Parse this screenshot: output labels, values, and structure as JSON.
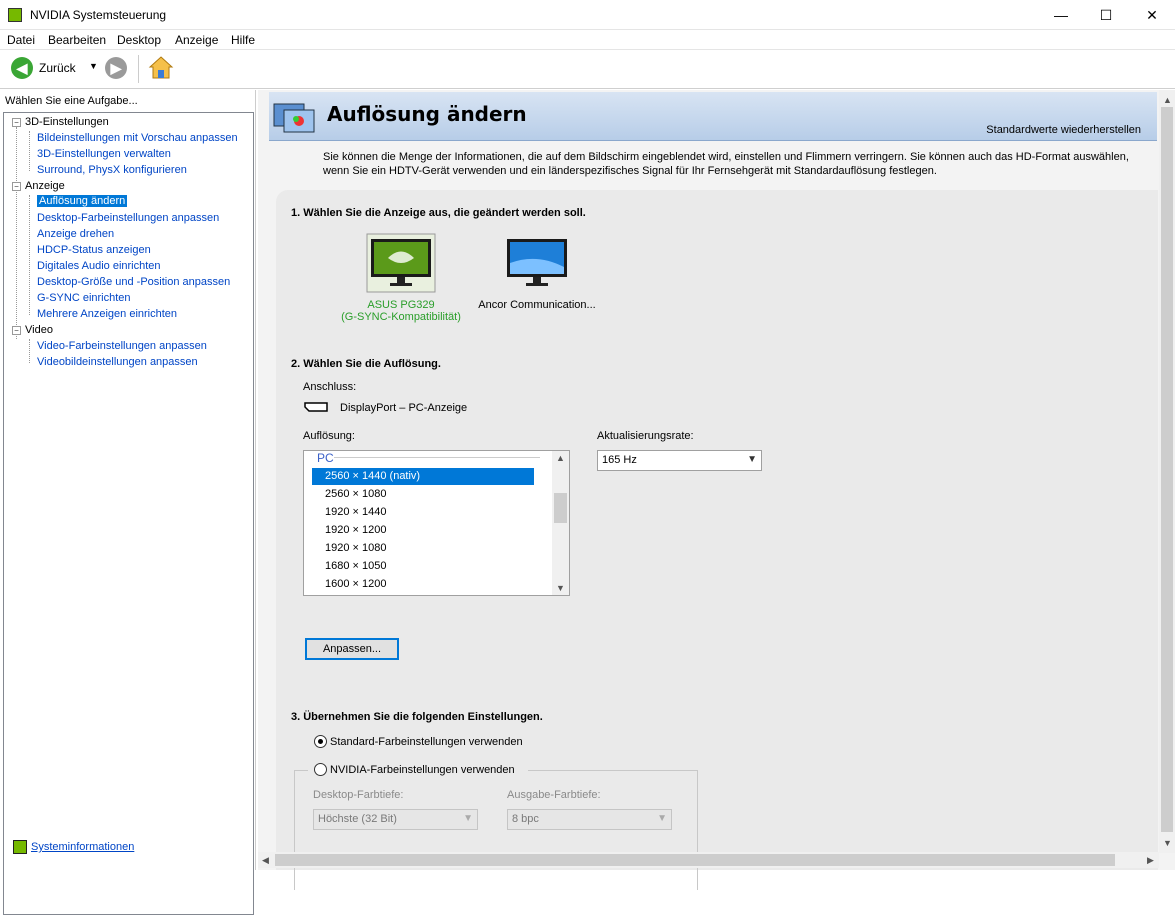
{
  "window": {
    "title": "NVIDIA Systemsteuerung",
    "min": "—",
    "max": "☐",
    "close": "✕"
  },
  "menu": [
    "Datei",
    "Bearbeiten",
    "Desktop",
    "Anzeige",
    "Hilfe"
  ],
  "toolbar": {
    "back_label": "Zurück"
  },
  "tasks": {
    "header": "Wählen Sie eine Aufgabe...",
    "categories": [
      {
        "label": "3D-Einstellungen",
        "items": [
          "Bildeinstellungen mit Vorschau anpassen",
          "3D-Einstellungen verwalten",
          "Surround, PhysX konfigurieren"
        ]
      },
      {
        "label": "Anzeige",
        "items": [
          "Auflösung ändern",
          "Desktop-Farbeinstellungen anpassen",
          "Anzeige drehen",
          "HDCP-Status anzeigen",
          "Digitales Audio einrichten",
          "Desktop-Größe und -Position anpassen",
          "G-SYNC einrichten",
          "Mehrere Anzeigen einrichten"
        ]
      },
      {
        "label": "Video",
        "items": [
          "Video-Farbeinstellungen anpassen",
          "Videobildeinstellungen anpassen"
        ]
      }
    ],
    "selected": "Auflösung ändern"
  },
  "sysinfo_link": "Systeminformationen",
  "page": {
    "title": "Auflösung ändern",
    "restore_defaults": "Standardwerte wiederherstellen",
    "intro": "Sie können die Menge der Informationen, die auf dem Bildschirm eingeblendet wird, einstellen und Flimmern verringern. Sie können auch das HD-Format auswählen, wenn Sie ein HDTV-Gerät verwenden und ein länderspezifisches Signal für Ihr Fernsehgerät mit Standardauflösung festlegen.",
    "step1": "1. Wählen Sie die Anzeige aus, die geändert werden soll.",
    "displays": [
      {
        "name": "ASUS PG329",
        "sub": "(G-SYNC-Kompatibilität)",
        "selected": true
      },
      {
        "name": "Ancor Communication...",
        "sub": "",
        "selected": false
      }
    ],
    "step2": "2. Wählen Sie die Auflösung.",
    "connector_label": "Anschluss:",
    "connector_value": "DisplayPort – PC-Anzeige",
    "resolution_label": "Auflösung:",
    "resolution_group": "PC",
    "resolutions": [
      "2560 × 1440 (nativ)",
      "2560 × 1080",
      "1920 × 1440",
      "1920 × 1200",
      "1920 × 1080",
      "1680 × 1050",
      "1600 × 1200"
    ],
    "selected_resolution": "2560 × 1440 (nativ)",
    "refresh_label": "Aktualisierungsrate:",
    "refresh_value": "165 Hz",
    "customize_button": "Anpassen...",
    "step3": "3. Übernehmen Sie die folgenden Einstellungen.",
    "radio_default": "Standard-Farbeinstellungen verwenden",
    "radio_nvidia": "NVIDIA-Farbeinstellungen verwenden",
    "color_depth_label": "Desktop-Farbtiefe:",
    "color_depth_value": "Höchste (32 Bit)",
    "output_depth_label": "Ausgabe-Farbtiefe:",
    "output_depth_value": "8 bpc"
  },
  "colors": {
    "nvidia_green": "#76b900",
    "selection": "#0078d7",
    "link": "#0045c6"
  }
}
